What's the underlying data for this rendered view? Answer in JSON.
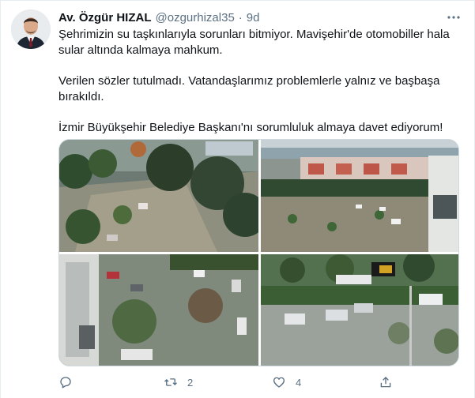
{
  "tweet": {
    "author_name": "Av. Özgür HIZAL",
    "handle": "@ozgurhizal35",
    "separator": "·",
    "time": "9d",
    "paragraphs": [
      "Şehrimizin su taşkınlarıyla sorunları bitmiyor. Mavişehir'de otomobiller hala sular altında kalmaya mahkum.",
      "Verilen sözler tutulmadı. Vatandaşlarımız problemlerle yalnız ve başbaşa bırakıldı.",
      "İzmir Büyükşehir Belediye Başkanı'nı sorumluluk almaya davet ediyorum!"
    ]
  },
  "actions": {
    "reply_count": "",
    "retweet_count": "2",
    "like_count": "4"
  },
  "icons": {
    "more": "more-options-icon",
    "reply": "reply-icon",
    "retweet": "retweet-icon",
    "like": "like-icon",
    "share": "share-icon"
  },
  "colors": {
    "text_primary": "#0f1419",
    "text_secondary": "#5b7083",
    "border": "#cfd9de"
  }
}
